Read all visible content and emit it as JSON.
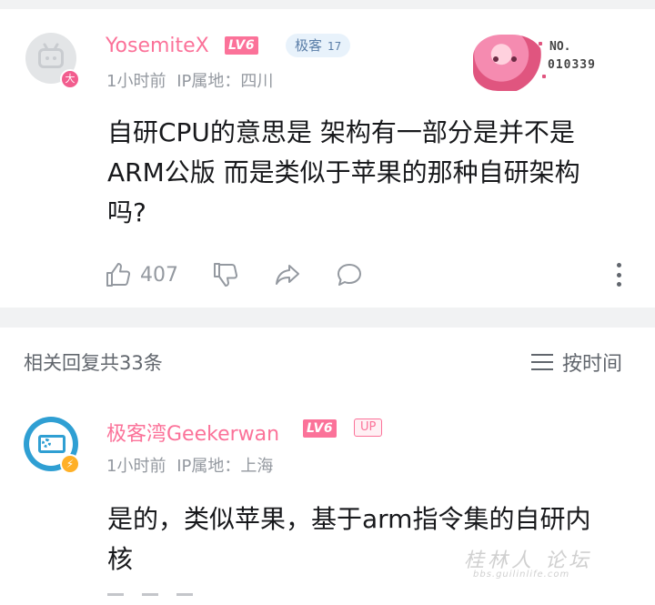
{
  "comment_1": {
    "username": "YosemiteX",
    "level": "LV6",
    "badge_label": "极客",
    "badge_number": "17",
    "vip_badge": "大",
    "time": "1小时前",
    "ip_location": "IP属地：四川",
    "decoration_label": "NO.",
    "decoration_id": "010339",
    "content_lines": [
      "自研CPU的意思是 架构有一部分是并不是",
      "ARM公版 而是类似于苹果的那种自研架构",
      "吗?"
    ],
    "like_count": "407",
    "icons": {
      "like": "thumb-up-icon",
      "dislike": "thumb-down-icon",
      "share": "share-icon",
      "reply": "comment-icon",
      "more": "more-vertical-icon"
    }
  },
  "replies_section": {
    "count_label": "相关回复共33条",
    "sort_label": "按时间",
    "sort_icon": "sort-lines-icon"
  },
  "comment_2": {
    "username": "极客湾Geekerwan",
    "level": "LV6",
    "up_tag": "UP",
    "time": "1小时前",
    "ip_location": "IP属地：上海",
    "content_lines": [
      "是的，类似苹果，基于arm指令集的自研内",
      "核"
    ]
  },
  "watermark": {
    "main": "桂林人 论坛",
    "sub": "bbs.guilinlife.com"
  },
  "colors": {
    "brand_pink": "#fb7299",
    "meta_gray": "#9499a0",
    "text_dark": "#18191c",
    "divider_gray": "#f1f2f3"
  }
}
